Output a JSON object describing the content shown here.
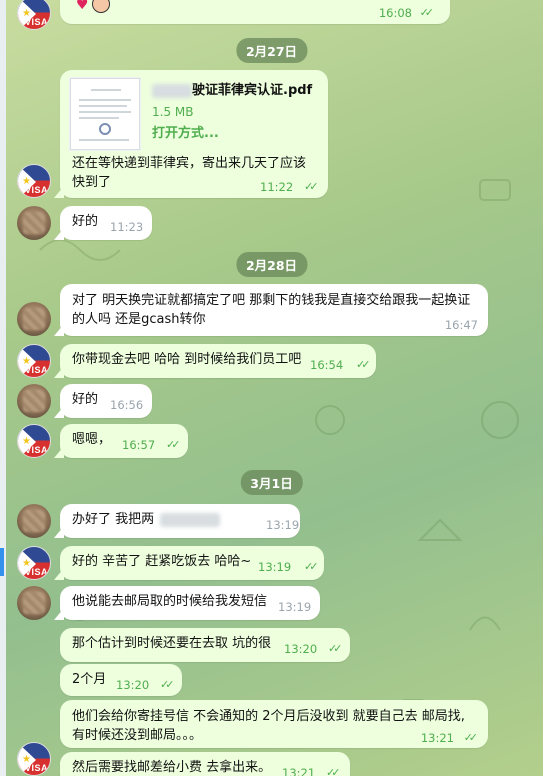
{
  "messages": {
    "top_time": "16:08",
    "file_name": "驶证菲律宾认证.pdf",
    "file_size": "1.5 MB",
    "file_action": "打开方式...",
    "m_feb27_1": "还在等快递到菲律宾，寄出来几天了应该快到了",
    "m_feb27_1_time": "11:22",
    "m_feb27_2": "好的",
    "m_feb27_2_time": "11:23",
    "m_feb28_1": "对了 明天换完证就都搞定了吧 那剩下的钱我是直接交给跟我一起换证的人吗  还是gcash转你",
    "m_feb28_1_time": "16:47",
    "m_feb28_2": "你带现金去吧 哈哈 到时候给我们员工吧",
    "m_feb28_2_time": "16:54",
    "m_feb28_3": "好的",
    "m_feb28_3_time": "16:56",
    "m_feb28_4": "嗯嗯，",
    "m_feb28_4_time": "16:57",
    "m_mar1_1": "办好了 我把两",
    "m_mar1_1_time": "13:19",
    "m_mar1_2": "好的 辛苦了  赶紧吃饭去 哈哈~",
    "m_mar1_2_time": "13:19",
    "m_mar1_3": "他说能去邮局取的时候给我发短信",
    "m_mar1_3_time": "13:19",
    "m_mar1_4": "那个估计到时候还要在去取  坑的很",
    "m_mar1_4_time": "13:20",
    "m_mar1_5": "2个月",
    "m_mar1_5_time": "13:20",
    "m_mar1_6a": "他们会给你寄挂号信 不会通知的  2个月后没收到 就要自己去 邮局找,",
    "m_mar1_6b": "有时候还没到邮局。。。",
    "m_mar1_6_time": "13:21",
    "m_mar1_7": "然后需要找邮差给小费 去拿出来。",
    "m_mar1_7_time": "13:21"
  },
  "dates": {
    "d1": "2月27日",
    "d2": "2月28日",
    "d3": "3月1日"
  },
  "icons": {
    "sent_check": "double-check-icon",
    "heart": "heart-emoji",
    "emoji_face": "face-emoji"
  },
  "colors": {
    "outgoing_bubble": "#eeffde",
    "incoming_bubble": "#ffffff",
    "time_green": "#4fae4e",
    "date_pill": "#6c8c5c"
  }
}
